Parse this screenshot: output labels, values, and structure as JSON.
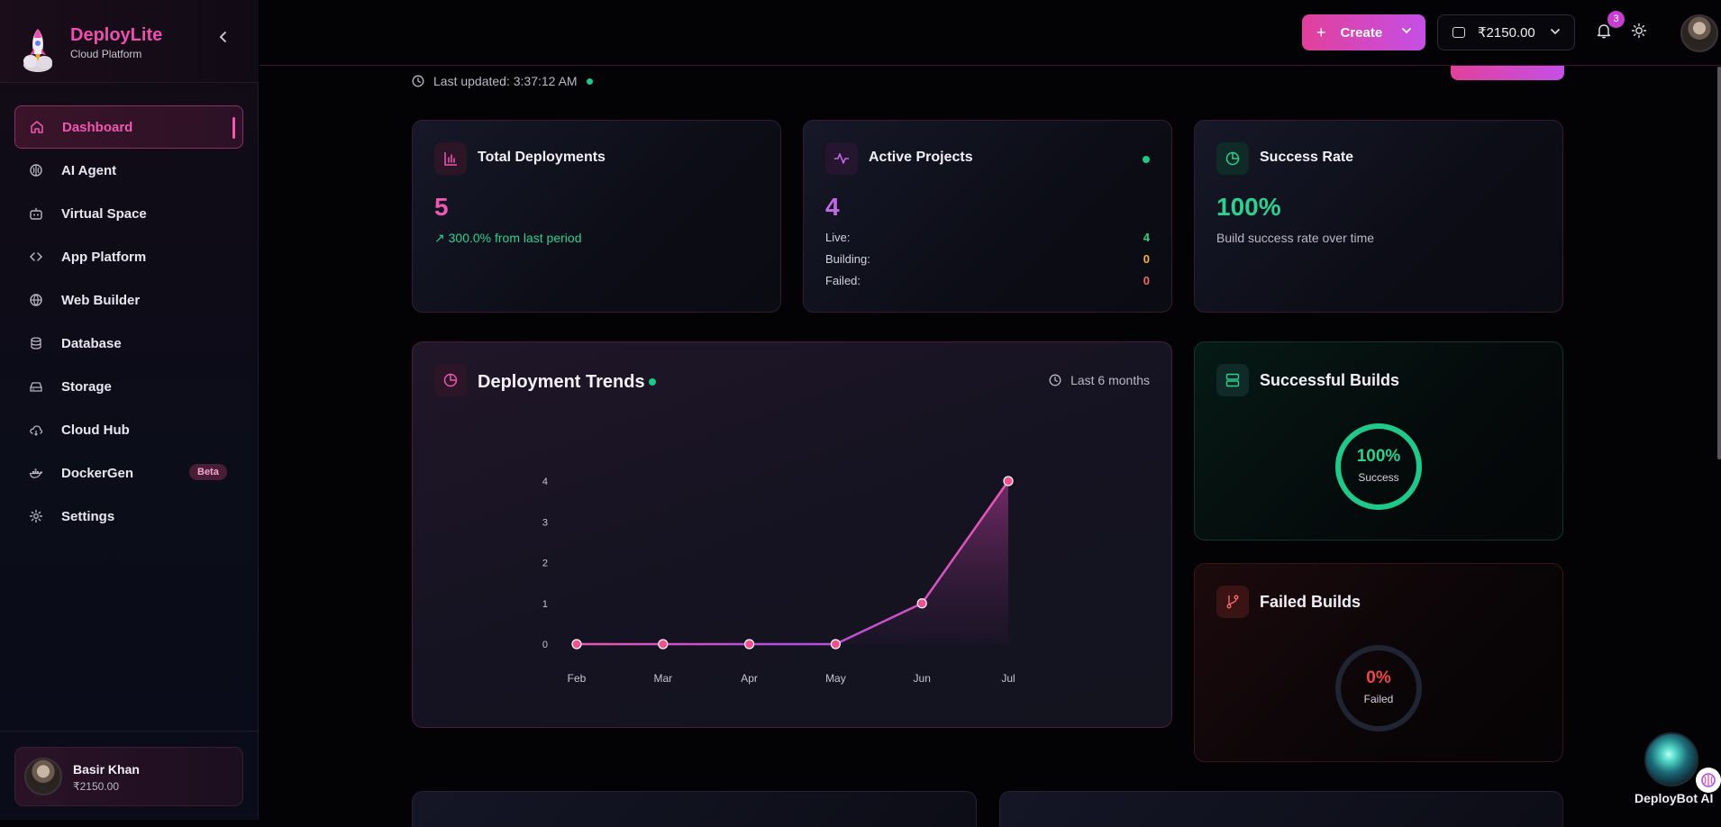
{
  "app": {
    "name": "DeployLite",
    "subtitle": "Cloud Platform"
  },
  "sidebar": {
    "items": [
      {
        "label": "Dashboard",
        "icon": "home-icon",
        "active": true
      },
      {
        "label": "AI Agent",
        "icon": "brain-icon"
      },
      {
        "label": "Virtual Space",
        "icon": "bot-icon"
      },
      {
        "label": "App Platform",
        "icon": "code-icon"
      },
      {
        "label": "Web Builder",
        "icon": "globe-icon"
      },
      {
        "label": "Database",
        "icon": "database-icon"
      },
      {
        "label": "Storage",
        "icon": "hard-drive-icon"
      },
      {
        "label": "Cloud Hub",
        "icon": "cloud-icon"
      },
      {
        "label": "DockerGen",
        "icon": "docker-icon",
        "badge": "Beta"
      },
      {
        "label": "Settings",
        "icon": "gear-icon"
      }
    ],
    "user": {
      "name": "Basir Khan",
      "balance": "₹2150.00"
    }
  },
  "topbar": {
    "create_label": "Create",
    "wallet_amount": "₹2150.00",
    "notification_count": "3"
  },
  "dashboard": {
    "last_updated": "Last updated: 3:37:12 AM",
    "total_deployments": {
      "title": "Total Deployments",
      "value": "5",
      "change": "↗ 300.0% from last period"
    },
    "active_projects": {
      "title": "Active Projects",
      "value": "4",
      "rows": [
        {
          "label": "Live:",
          "value": "4",
          "color": "#2fd08f"
        },
        {
          "label": "Building:",
          "value": "0",
          "color": "#f2b632"
        },
        {
          "label": "Failed:",
          "value": "0",
          "color": "#f06b6b"
        }
      ]
    },
    "success_rate": {
      "title": "Success Rate",
      "value": "100%",
      "caption": "Build success rate over time"
    },
    "trends": {
      "title": "Deployment Trends",
      "range": "Last 6 months"
    },
    "successful_builds": {
      "title": "Successful Builds",
      "value": "100%",
      "label": "Success",
      "fraction": 1.0
    },
    "failed_builds": {
      "title": "Failed Builds",
      "value": "0%",
      "label": "Failed",
      "fraction": 0.0
    }
  },
  "chart_data": {
    "type": "area",
    "categories": [
      "Feb",
      "Mar",
      "Apr",
      "May",
      "Jun",
      "Jul"
    ],
    "values": [
      0,
      0,
      0,
      0,
      1,
      4
    ],
    "yticks": [
      "0",
      "1",
      "2",
      "3",
      "4"
    ],
    "ylim": [
      0,
      4
    ],
    "title": "",
    "xlabel": "",
    "ylabel": ""
  },
  "assistant": {
    "label": "DeployBot AI"
  }
}
